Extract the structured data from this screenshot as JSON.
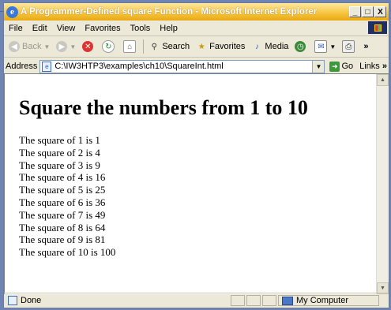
{
  "window": {
    "title": "A Programmer-Defined square Function - Microsoft Internet Explorer",
    "min_label": "_",
    "max_label": "□",
    "close_label": "X"
  },
  "menu": [
    "File",
    "Edit",
    "View",
    "Favorites",
    "Tools",
    "Help"
  ],
  "toolbar": {
    "back_label": "Back",
    "search_label": "Search",
    "favorites_label": "Favorites",
    "media_label": "Media"
  },
  "address": {
    "label": "Address",
    "url": "C:\\IW3HTP3\\examples\\ch10\\SquareInt.html",
    "go_label": "Go",
    "links_label": "Links"
  },
  "page": {
    "heading": "Square the numbers from 1 to 10",
    "lines": [
      "The square of 1 is 1",
      "The square of 2 is 4",
      "The square of 3 is 9",
      "The square of 4 is 16",
      "The square of 5 is 25",
      "The square of 6 is 36",
      "The square of 7 is 49",
      "The square of 8 is 64",
      "The square of 9 is 81",
      "The square of 10 is 100"
    ]
  },
  "status": {
    "text": "Done",
    "zone": "My Computer"
  },
  "colors": {
    "titlebar": "#f7c542",
    "desktop": "#6d84b4"
  }
}
